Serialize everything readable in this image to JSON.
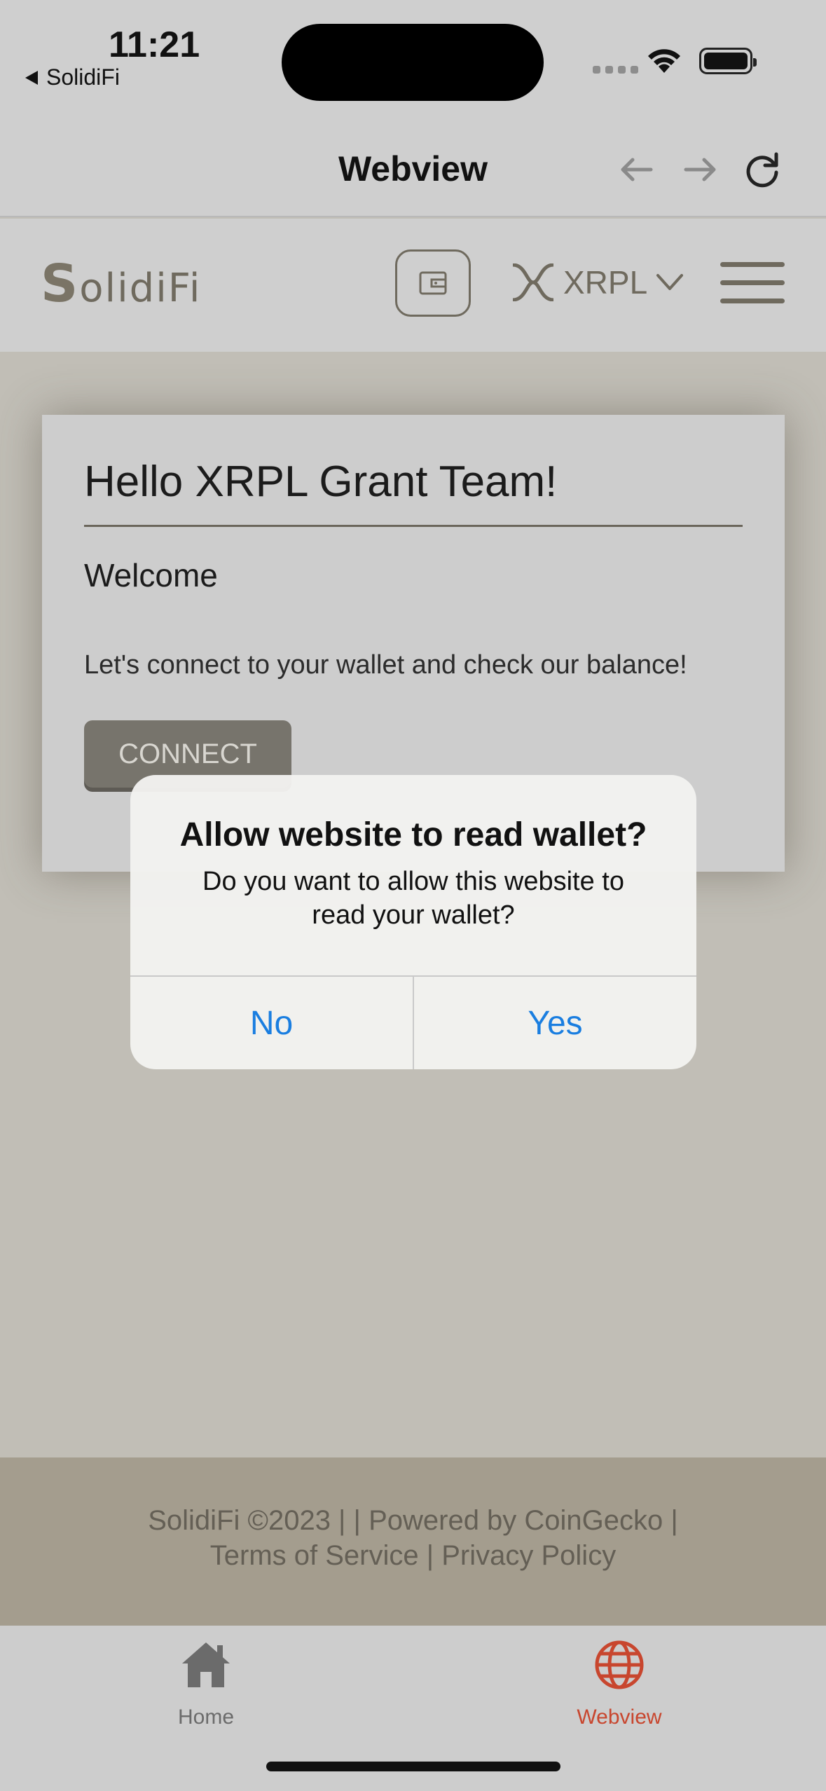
{
  "status_bar": {
    "time": "11:21",
    "back_app_label": "SolidiFi"
  },
  "nav": {
    "title": "Webview",
    "back_icon": "arrow-left-icon",
    "forward_icon": "arrow-right-icon",
    "reload_icon": "reload-icon"
  },
  "site_header": {
    "logo_s": "S",
    "logo_rest": "olidiFi",
    "chain_label": "XRPL",
    "wallet_icon": "wallet-icon",
    "menu_icon": "hamburger-icon"
  },
  "card": {
    "title": "Hello XRPL Grant Team!",
    "subtitle": "Welcome",
    "text": "Let's connect to your wallet and check our balance!",
    "connect_label": "CONNECT"
  },
  "alert": {
    "title": "Allow website to read wallet?",
    "message": "Do you want to allow this website to read your wallet?",
    "no_label": "No",
    "yes_label": "Yes"
  },
  "footer": {
    "line1": "SolidiFi ©2023 | | Powered by CoinGecko |",
    "line2": "Terms of Service | Privacy Policy"
  },
  "tabbar": {
    "home_label": "Home",
    "webview_label": "Webview",
    "active_color": "#c8462e",
    "inactive_color": "#6b6b6b"
  },
  "colors": {
    "accent_blue": "#1a7ee0",
    "brand_brown": "#6f6a5e"
  }
}
